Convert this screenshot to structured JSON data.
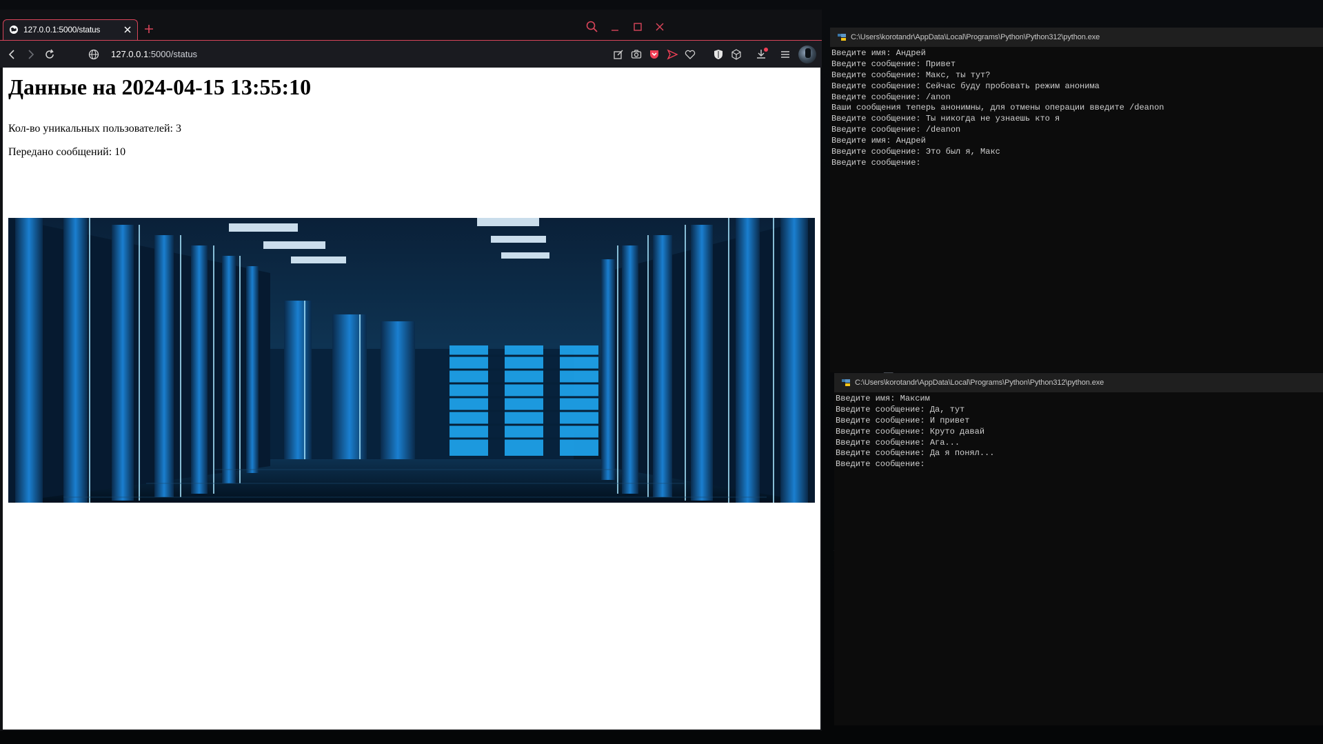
{
  "browser": {
    "tab_title": "127.0.0.1:5000/status",
    "url_host": "127.0.0.1",
    "url_path": ":5000/status",
    "accent_color": "#d9455a"
  },
  "page": {
    "heading": "Данные на 2024-04-15 13:55:10",
    "unique_users": "Кол-во уникальных пользователей: 3",
    "messages_sent": "Передано сообщений: 10",
    "image": "server-room-photo"
  },
  "console1": {
    "title": "C:\\Users\\korotandr\\AppData\\Local\\Programs\\Python\\Python312\\python.exe",
    "lines": [
      "Введите имя: Андрей",
      "Введите сообщение: Привет",
      "Введите сообщение: Макс, ты тут?",
      "Введите сообщение: Сейчас буду пробовать режим анонима",
      "Введите сообщение: /anon",
      "Ваши сообщения теперь анонимны, для отмены операции введите /deanon",
      "Введите сообщение: Ты никогда не узнаешь кто я",
      "Введите сообщение: /deanon",
      "Введите имя: Андрей",
      "Введите сообщение: Это был я, Макс",
      "Введите сообщение:"
    ]
  },
  "console2": {
    "title": "C:\\Users\\korotandr\\AppData\\Local\\Programs\\Python\\Python312\\python.exe",
    "lines": [
      "Введите имя: Максим",
      "Введите сообщение: Да, тут",
      "Введите сообщение: И привет",
      "Введите сообщение: Круто давай",
      "Введите сообщение: Ага...",
      "Введите сообщение: Да я понял...",
      "Введите сообщение:"
    ]
  }
}
